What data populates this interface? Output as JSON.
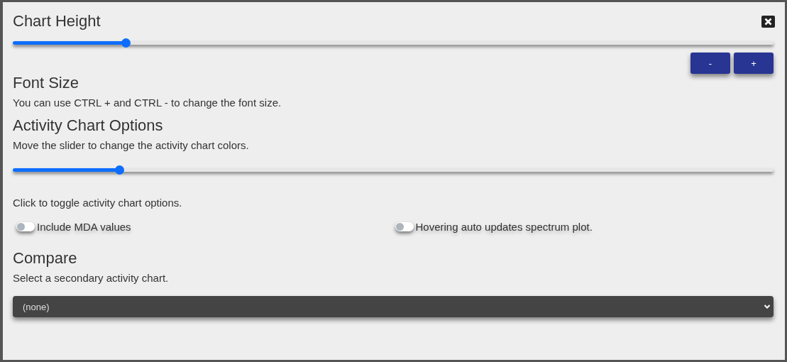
{
  "chart_height": {
    "title": "Chart Height",
    "level": 0.148,
    "buttons": [
      "-",
      "+"
    ]
  },
  "font_size": {
    "title": "Font Size",
    "text": "You can use CTRL + and CTRL - to change the font size."
  },
  "activity_chart_options": {
    "title": "Activity Chart Options",
    "slider_text": "Move the slider to change the activity chart colors.",
    "level": 0.14,
    "toggle_text": "Click to toggle activity chart options.",
    "toggles": [
      {
        "label": "Include MDA values",
        "on": false
      },
      {
        "label": "Hovering auto updates spectrum plot.",
        "on": false
      }
    ]
  },
  "compare": {
    "title": "Compare",
    "text": "Select a secondary activity chart.",
    "select_value": "(none)"
  }
}
